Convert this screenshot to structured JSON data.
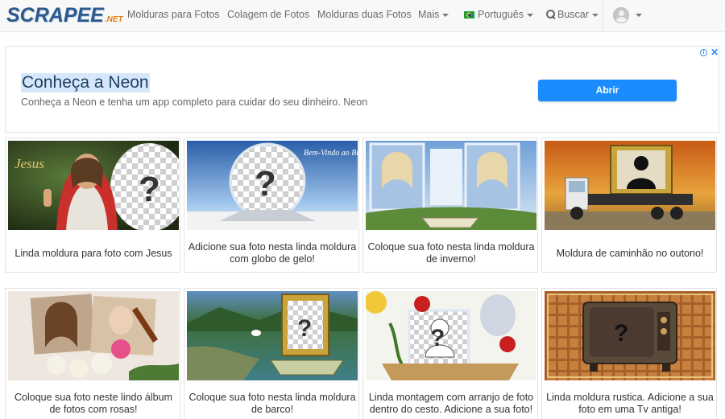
{
  "navbar": {
    "logo": {
      "main": "SCRAPEE",
      "suffix": ".NET"
    },
    "links": [
      {
        "label": "Molduras para Fotos"
      },
      {
        "label": "Colagem de Fotos"
      },
      {
        "label": "Molduras duas Fotos"
      },
      {
        "label": "Mais"
      }
    ],
    "language": {
      "label": "Português"
    },
    "search": {
      "label": "Buscar"
    }
  },
  "ad": {
    "title": "Conheça a Neon",
    "description": "Conheça a Neon e tenha um app completo para cuidar do seu dinheiro. Neon",
    "button_label": "Abrir",
    "info_icon": "i",
    "close_icon": "✕"
  },
  "cards": [
    {
      "caption": "Linda moldura para foto com Jesus",
      "image_text": "Jesus"
    },
    {
      "caption": "Adicione sua foto nesta linda moldura com globo de gelo!",
      "image_text": "Bem-Vindo ao Brasil"
    },
    {
      "caption": "Coloque sua foto nesta linda moldura de inverno!"
    },
    {
      "caption": "Moldura de caminhão no outono!"
    },
    {
      "caption": "Coloque sua foto neste lindo álbum de fotos com rosas!"
    },
    {
      "caption": "Coloque sua foto nesta linda moldura de barco!"
    },
    {
      "caption": "Linda montagem com arranjo de foto dentro do cesto. Adicione a sua foto!"
    },
    {
      "caption": "Linda moldura rustica. Adicione a sua foto em uma Tv antiga!"
    }
  ],
  "colors": {
    "logo": "#2c5a8c",
    "logo_suffix": "#e07b1a",
    "ad_button": "#1a8cff",
    "navbar_bg": "#f8f8f8"
  }
}
